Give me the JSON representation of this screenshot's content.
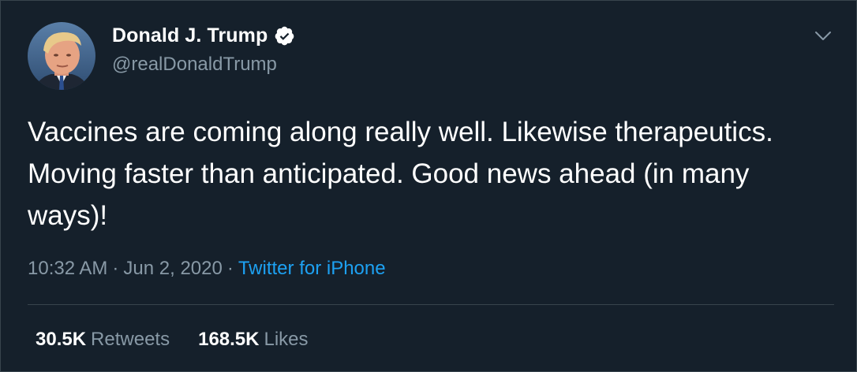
{
  "tweet": {
    "author": {
      "display_name": "Donald J. Trump",
      "handle": "@realDonaldTrump",
      "verified": true
    },
    "text": "Vaccines are coming along really well. Likewise therapeutics. Moving faster than anticipated. Good news ahead (in many ways)!",
    "time": "10:32 AM",
    "date": "Jun 2, 2020",
    "separator": "·",
    "source": "Twitter for iPhone"
  },
  "stats": {
    "retweets_count": "30.5K",
    "retweets_label": "Retweets",
    "likes_count": "168.5K",
    "likes_label": "Likes"
  },
  "icons": {
    "verified": "verified-badge-icon",
    "menu": "chevron-down-icon"
  },
  "colors": {
    "background": "#15202b",
    "secondary_text": "#8899a6",
    "accent": "#1da1f2",
    "divider": "#38444d"
  }
}
